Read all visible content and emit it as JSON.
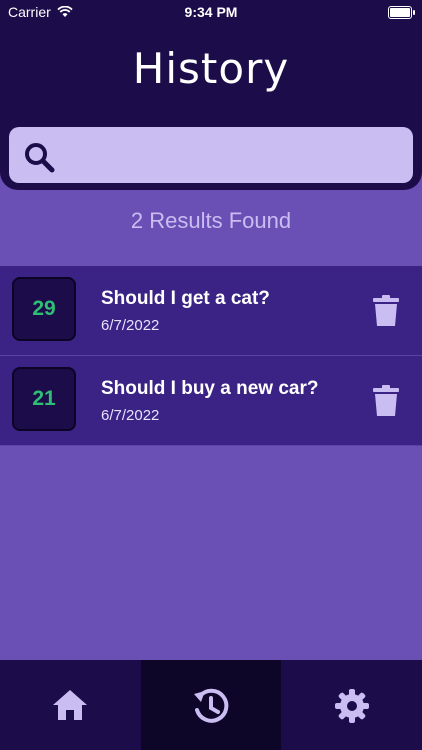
{
  "status_bar": {
    "carrier": "Carrier",
    "time": "9:34 PM"
  },
  "header": {
    "title": "History"
  },
  "search": {
    "placeholder": "",
    "value": ""
  },
  "results": {
    "count_text": "2 Results Found"
  },
  "history": [
    {
      "score": "29",
      "question": "Should I get a cat?",
      "date": "6/7/2022"
    },
    {
      "score": "21",
      "question": "Should I buy a new car?",
      "date": "6/7/2022"
    }
  ],
  "tabs": [
    {
      "icon": "home-icon",
      "active": false
    },
    {
      "icon": "history-icon",
      "active": true
    },
    {
      "icon": "gear-icon",
      "active": false
    }
  ],
  "colors": {
    "header_bg": "#1c0c4a",
    "page_bg": "#6a50b5",
    "item_bg": "#3a2385",
    "search_bg": "#c9bdf2",
    "score_text": "#2ebf74",
    "icon_color": "#c9bdf2"
  }
}
